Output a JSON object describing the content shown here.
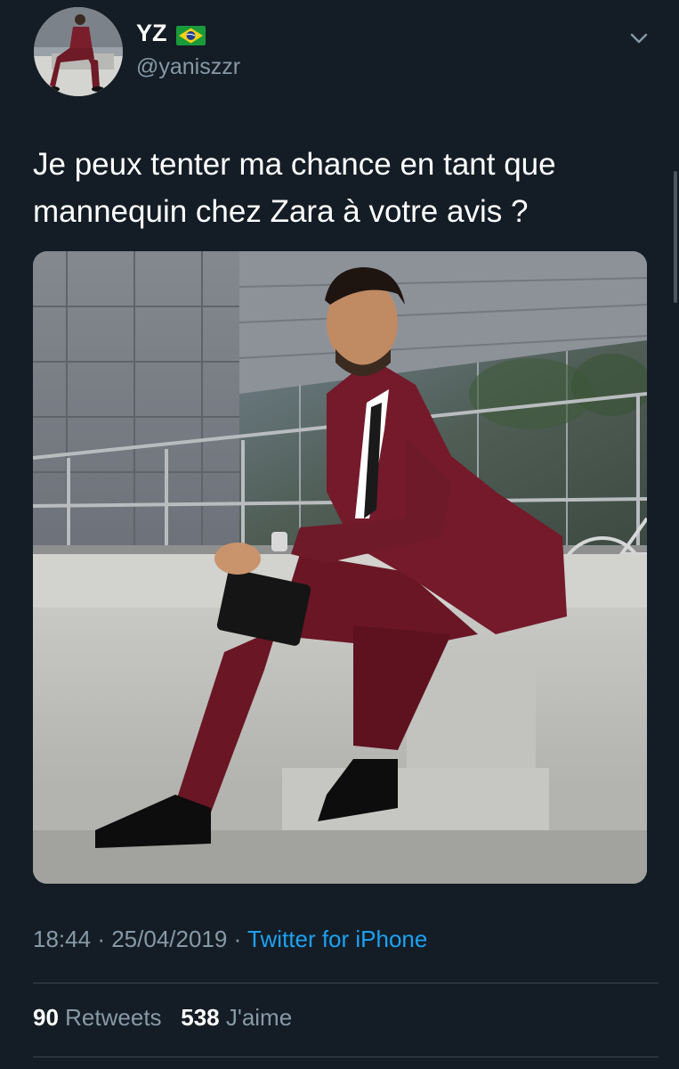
{
  "tweet": {
    "author": {
      "display_name": "YZ",
      "flag": "brazil-flag",
      "handle": "@yaniszzr"
    },
    "text_line1": "Je peux tenter ma chance en tant que",
    "text_line2": "mannequin chez Zara à votre avis ?",
    "media": {
      "description_icon": "photo"
    },
    "time": "18:44",
    "date": "25/04/2019",
    "separator": "·",
    "source": "Twitter for iPhone",
    "retweets_count": "90",
    "retweets_label": "Retweets",
    "likes_count": "538",
    "likes_label": "J'aime"
  },
  "colors": {
    "background": "#141d26",
    "secondary_text": "#8899a6",
    "link": "#1da1f2",
    "divider": "#38444d"
  }
}
